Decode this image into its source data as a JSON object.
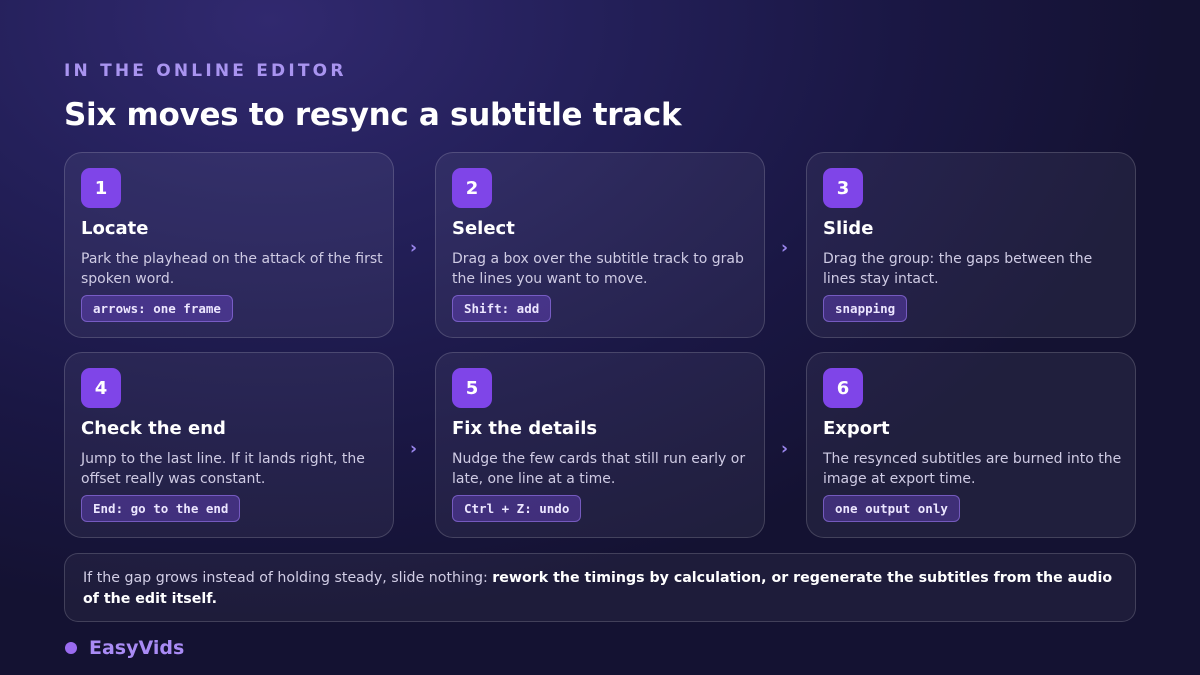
{
  "eyebrow": "IN THE ONLINE EDITOR",
  "title": "Six moves to resync a subtitle track",
  "steps": [
    {
      "number": "1",
      "title": "Locate",
      "description": "Park the playhead on the attack of the first spoken word.",
      "tag": "arrows: one frame"
    },
    {
      "number": "2",
      "title": "Select",
      "description": "Drag a box over the subtitle track to grab the lines you want to move.",
      "tag": "Shift: add"
    },
    {
      "number": "3",
      "title": "Slide",
      "description": "Drag the group: the gaps between the lines stay intact.",
      "tag": "snapping"
    },
    {
      "number": "4",
      "title": "Check the end",
      "description": "Jump to the last line. If it lands right, the offset really was constant.",
      "tag": "End: go to the end"
    },
    {
      "number": "5",
      "title": "Fix the details",
      "description": "Nudge the few cards that still run early or late, one line at a time.",
      "tag": "Ctrl + Z: undo"
    },
    {
      "number": "6",
      "title": "Export",
      "description": "The resynced subtitles are burned into the image at export time.",
      "tag": "one output only"
    }
  ],
  "arrow_glyph": "›",
  "note": {
    "lead": "If the gap grows instead of holding steady, slide nothing: ",
    "emphasis": "rework the timings by calculation, or regenerate the subtitles from the audio of the edit itself."
  },
  "brand": {
    "name": "EasyVids",
    "color": "#9a6bf0"
  },
  "colors": {
    "accent": "#7f45e8",
    "eyebrow": "#a994f0"
  }
}
